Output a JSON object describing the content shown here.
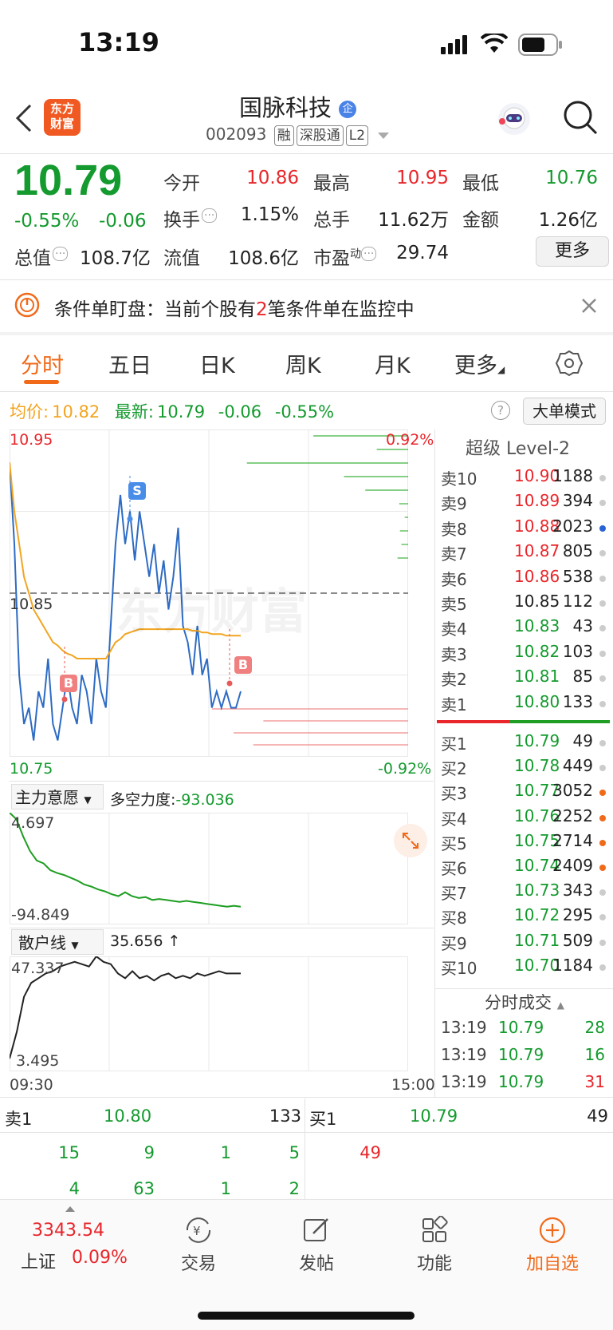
{
  "status": {
    "time": "13:19"
  },
  "header": {
    "logo_text": "东方财富",
    "stock_name": "国脉科技",
    "badge": "企",
    "code": "002093",
    "tags": [
      "融",
      "深股通",
      "L2"
    ]
  },
  "quote": {
    "price": "10.79",
    "change_pct": "-0.55%",
    "change": "-0.06",
    "open_label": "今开",
    "open": "10.86",
    "high_label": "最高",
    "high": "10.95",
    "low_label": "最低",
    "low": "10.76",
    "turnover_label": "换手",
    "turnover": "1.15%",
    "volume_label": "总手",
    "volume": "11.62万",
    "amount_label": "金额",
    "amount": "1.26亿",
    "mcap_label": "总值",
    "mcap": "108.7亿",
    "float_label": "流值",
    "float": "108.6亿",
    "pe_label": "市盈",
    "pe_sup": "动",
    "pe": "29.74",
    "more_label": "更多"
  },
  "notice": {
    "prefix": "条件单盯盘：当前个股有",
    "count": "2",
    "suffix": "笔条件单在监控中"
  },
  "tabs": [
    "分时",
    "五日",
    "日K",
    "周K",
    "月K",
    "更多"
  ],
  "info_line": {
    "avg_label": "均价:",
    "avg": "10.82",
    "latest_label": "最新:",
    "latest": "10.79",
    "chg": "-0.06",
    "chg_pct": "-0.55%",
    "mode": "大单模式"
  },
  "chart_labels": {
    "top_price": "10.95",
    "mid_price": "10.85",
    "bottom_price": "10.75",
    "top_pct": "0.92%",
    "bottom_pct": "-0.92%",
    "sell_marker": "S",
    "buy_marker": "B",
    "watermark": "东方财富"
  },
  "chart_data": [
    {
      "type": "line",
      "title": "",
      "ylim": [
        10.75,
        10.95
      ],
      "series": [
        {
          "name": "最新",
          "color": "#2d6bc4",
          "values": [
            10.93,
            10.88,
            10.8,
            10.77,
            10.78,
            10.76,
            10.79,
            10.78,
            10.81,
            10.77,
            10.76,
            10.78,
            10.8,
            10.78,
            10.77,
            10.8,
            10.79,
            10.77,
            10.81,
            10.79,
            10.78,
            10.83,
            10.88,
            10.91,
            10.88,
            10.9,
            10.87,
            10.9,
            10.88,
            10.86,
            10.88,
            10.85,
            10.87,
            10.84,
            10.86,
            10.89,
            10.83,
            10.82,
            10.8,
            10.83,
            10.8,
            10.81,
            10.78,
            10.79,
            10.78,
            10.79,
            10.78,
            10.78,
            10.79
          ]
        },
        {
          "name": "均价",
          "color": "#f2a521",
          "values": [
            10.93,
            10.9,
            10.88,
            10.86,
            10.85,
            10.84,
            10.835,
            10.83,
            10.825,
            10.82,
            10.818,
            10.815,
            10.813,
            10.812,
            10.81,
            10.81,
            10.81,
            10.81,
            10.81,
            10.81,
            10.81,
            10.815,
            10.82,
            10.822,
            10.825,
            10.826,
            10.827,
            10.828,
            10.828,
            10.828,
            10.828,
            10.828,
            10.828,
            10.828,
            10.828,
            10.828,
            10.828,
            10.828,
            10.827,
            10.827,
            10.826,
            10.826,
            10.825,
            10.825,
            10.825,
            10.824,
            10.824,
            10.824,
            10.824
          ]
        }
      ]
    },
    {
      "type": "line",
      "title": "主力意愿",
      "ylabel": "多空力度:-93.036",
      "ylim": [
        -94.849,
        4.697
      ],
      "series": [
        {
          "name": "主力意愿",
          "color": "#1e9e22",
          "values": [
            4.697,
            -2,
            -20,
            -35,
            -45,
            -48,
            -55,
            -58,
            -60,
            -63,
            -66,
            -70,
            -72,
            -75,
            -77,
            -80,
            -82,
            -78,
            -82,
            -84,
            -83,
            -86,
            -85,
            -86,
            -87,
            -88,
            -87,
            -88,
            -89,
            -90,
            -91,
            -92,
            -93,
            -92,
            -93.036
          ]
        }
      ]
    },
    {
      "type": "line",
      "title": "散户线",
      "ylabel": "35.656 ↑",
      "ylim": [
        3.495,
        47.337
      ],
      "series": [
        {
          "name": "散户线",
          "color": "#222222",
          "values": [
            3.495,
            15,
            30,
            36,
            38,
            40,
            41,
            43,
            44,
            45,
            44,
            43,
            47.337,
            45,
            44,
            40,
            38,
            41,
            38,
            39,
            37,
            39,
            40,
            38,
            39,
            38,
            40,
            39,
            40,
            41,
            40,
            40,
            40
          ]
        }
      ]
    }
  ],
  "chart_time": {
    "start": "09:30",
    "end": "15:00"
  },
  "sub1": {
    "name": "主力意愿",
    "label": "多空力度:",
    "value": "-93.036",
    "top": "4.697",
    "bottom": "-94.849"
  },
  "sub2": {
    "name": "散户线",
    "value": "35.656 ↑",
    "top": "47.337",
    "bottom": "3.495"
  },
  "orderbook": {
    "title": "超级 Level-2",
    "asks": [
      {
        "label": "卖10",
        "price": "10.90",
        "vol": "1188",
        "c": "red",
        "dot": "gray"
      },
      {
        "label": "卖9",
        "price": "10.89",
        "vol": "394",
        "c": "red",
        "dot": "gray"
      },
      {
        "label": "卖8",
        "price": "10.88",
        "vol": "2023",
        "c": "red",
        "dot": "blue"
      },
      {
        "label": "卖7",
        "price": "10.87",
        "vol": "805",
        "c": "red",
        "dot": "gray"
      },
      {
        "label": "卖6",
        "price": "10.86",
        "vol": "538",
        "c": "red",
        "dot": "gray"
      },
      {
        "label": "卖5",
        "price": "10.85",
        "vol": "112",
        "c": "black",
        "dot": "gray"
      },
      {
        "label": "卖4",
        "price": "10.83",
        "vol": "43",
        "c": "green",
        "dot": "gray"
      },
      {
        "label": "卖3",
        "price": "10.82",
        "vol": "103",
        "c": "green",
        "dot": "gray"
      },
      {
        "label": "卖2",
        "price": "10.81",
        "vol": "85",
        "c": "green",
        "dot": "gray"
      },
      {
        "label": "卖1",
        "price": "10.80",
        "vol": "133",
        "c": "green",
        "dot": "gray"
      }
    ],
    "bids": [
      {
        "label": "买1",
        "price": "10.79",
        "vol": "49",
        "c": "green",
        "dot": "gray"
      },
      {
        "label": "买2",
        "price": "10.78",
        "vol": "449",
        "c": "green",
        "dot": "gray"
      },
      {
        "label": "买3",
        "price": "10.77",
        "vol": "3052",
        "c": "green",
        "dot": "orange"
      },
      {
        "label": "买4",
        "price": "10.76",
        "vol": "2252",
        "c": "green",
        "dot": "orange"
      },
      {
        "label": "买5",
        "price": "10.75",
        "vol": "2714",
        "c": "green",
        "dot": "orange"
      },
      {
        "label": "买6",
        "price": "10.74",
        "vol": "2409",
        "c": "green",
        "dot": "orange"
      },
      {
        "label": "买7",
        "price": "10.73",
        "vol": "343",
        "c": "green",
        "dot": "gray"
      },
      {
        "label": "买8",
        "price": "10.72",
        "vol": "295",
        "c": "green",
        "dot": "gray"
      },
      {
        "label": "买9",
        "price": "10.71",
        "vol": "509",
        "c": "green",
        "dot": "gray"
      },
      {
        "label": "买10",
        "price": "10.70",
        "vol": "1184",
        "c": "green",
        "dot": "gray"
      }
    ],
    "ticks_title": "分时成交",
    "ticks": [
      {
        "time": "13:19",
        "price": "10.79",
        "vol": "28",
        "c": "green"
      },
      {
        "time": "13:19",
        "price": "10.79",
        "vol": "16",
        "c": "green"
      },
      {
        "time": "13:19",
        "price": "10.79",
        "vol": "31",
        "c": "red"
      }
    ]
  },
  "queue": {
    "sell_label": "卖1",
    "sell_price": "10.80",
    "sell_vol": "133",
    "buy_label": "买1",
    "buy_price": "10.79",
    "buy_vol": "49",
    "sell_row1": [
      "15",
      "9",
      "1",
      "5"
    ],
    "sell_row2": [
      "4",
      "63",
      "1",
      "2"
    ],
    "buy_row1": [
      "49"
    ]
  },
  "bottom": {
    "index_value": "3343.54",
    "index_name": "上证",
    "index_pct": "0.09%",
    "trade": "交易",
    "post": "发帖",
    "func": "功能",
    "add": "加自选"
  }
}
